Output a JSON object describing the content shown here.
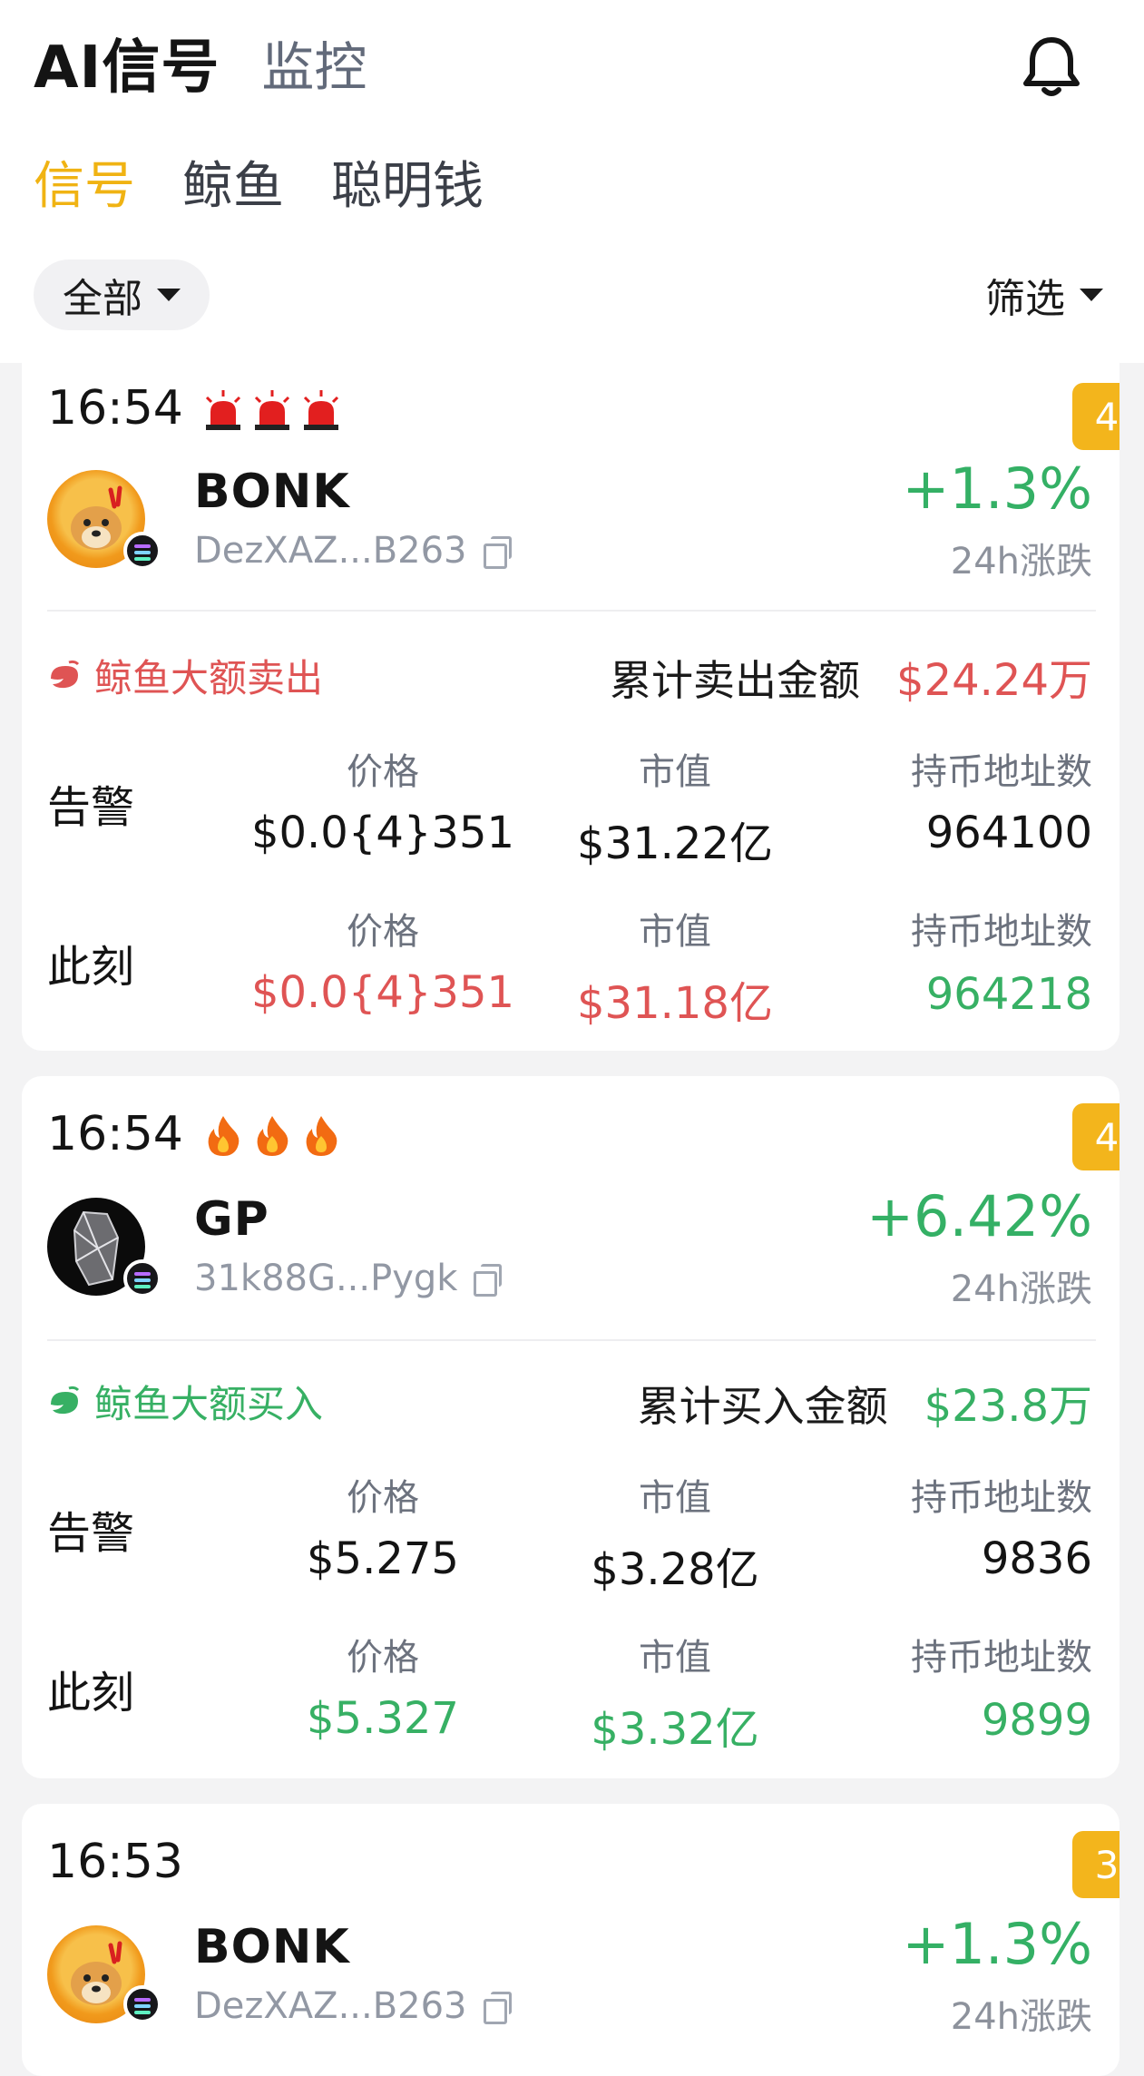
{
  "header": {
    "title": "AI信号",
    "nav_monitor": "监控",
    "tabs": [
      "信号",
      "鲸鱼",
      "聪明钱"
    ],
    "chip_label": "全部",
    "filter_label": "筛选"
  },
  "colors": {
    "accent": "#f0b313",
    "up": "#34b065",
    "down": "#df5454",
    "badge": "#f3b51c"
  },
  "table_labels": {
    "alert": "告警",
    "now": "此刻",
    "price": "价格",
    "mcap": "市值",
    "holders": "持币地址数",
    "change_label": "24h涨跌"
  },
  "cards": [
    {
      "time": "16:54",
      "badge": "4",
      "signal_icon": "siren-icon",
      "symbol": "BONK",
      "address": "DezXAZ...B263",
      "change": "+1.3%",
      "action": "鲸鱼大额卖出",
      "cum_label": "累计卖出金额",
      "cum_amount": "$24.24万",
      "alert": {
        "price": "$0.0{4}351",
        "mcap": "$31.22亿",
        "holders": "964100"
      },
      "now": {
        "price": "$0.0{4}351",
        "mcap": "$31.18亿",
        "holders": "964218"
      }
    },
    {
      "time": "16:54",
      "badge": "4",
      "signal_icon": "fire-icon",
      "symbol": "GP",
      "address": "31k88G...Pygk",
      "change": "+6.42%",
      "action": "鲸鱼大额买入",
      "cum_label": "累计买入金额",
      "cum_amount": "$23.8万",
      "alert": {
        "price": "$5.275",
        "mcap": "$3.28亿",
        "holders": "9836"
      },
      "now": {
        "price": "$5.327",
        "mcap": "$3.32亿",
        "holders": "9899"
      }
    },
    {
      "time": "16:53",
      "badge": "3",
      "symbol": "BONK",
      "address": "DezXAZ...B263",
      "change": "+1.3%"
    }
  ]
}
